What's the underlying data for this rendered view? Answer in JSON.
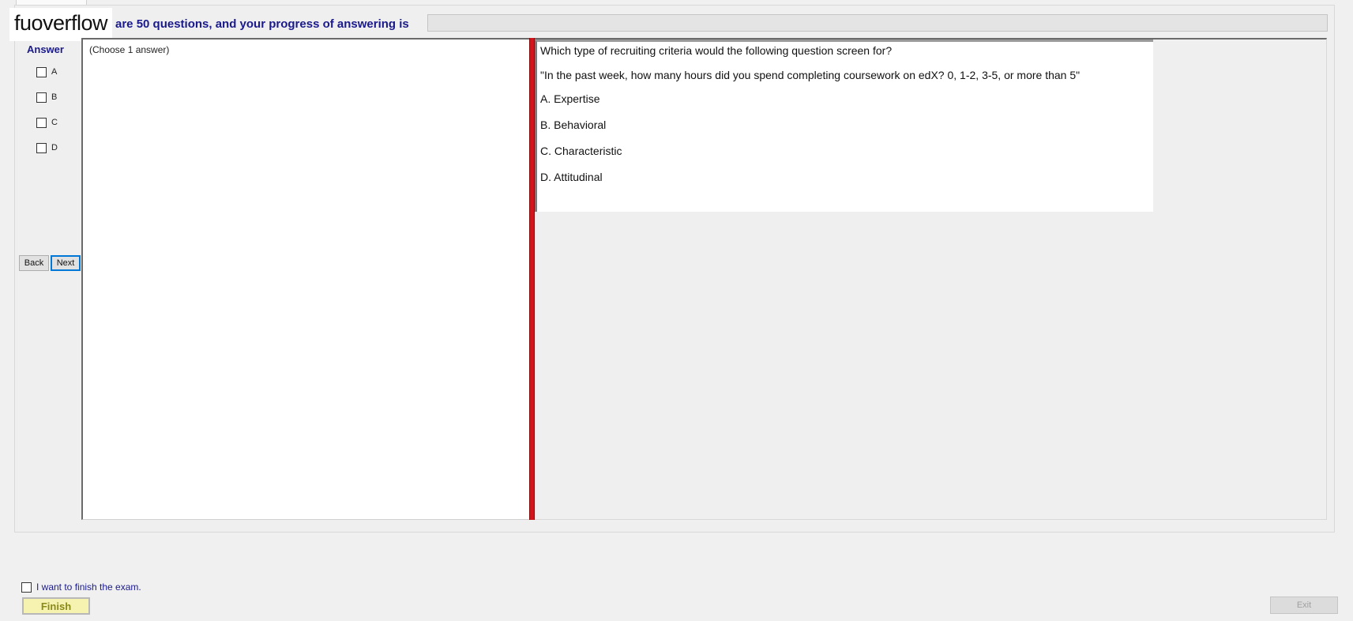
{
  "header": {
    "logo_text": "fuoverflow",
    "progress_text": "are 50 questions, and your progress of answering is",
    "progress_fraction": 0
  },
  "answer_panel": {
    "heading": "Answer",
    "options": [
      "A",
      "B",
      "C",
      "D"
    ],
    "back_label": "Back",
    "next_label": "Next"
  },
  "left_pane": {
    "instruction": "(Choose 1 answer)"
  },
  "question": {
    "stem": "Which type of recruiting criteria would the following question screen for?",
    "quote": "\"In the past week, how many hours did you spend completing coursework on edX? 0, 1-2, 3-5, or more than 5\"",
    "choices": [
      "A.  Expertise",
      "B.  Behavioral",
      "C.  Characteristic",
      "D.  Attitudinal"
    ]
  },
  "footer": {
    "finish_check_label": "I want to finish the exam.",
    "finish_label": "Finish",
    "exit_label": "Exit"
  },
  "colors": {
    "heading_blue": "#1a1a8c",
    "splitter_red": "#d4141a",
    "finish_yellow": "#f6f3b0"
  }
}
